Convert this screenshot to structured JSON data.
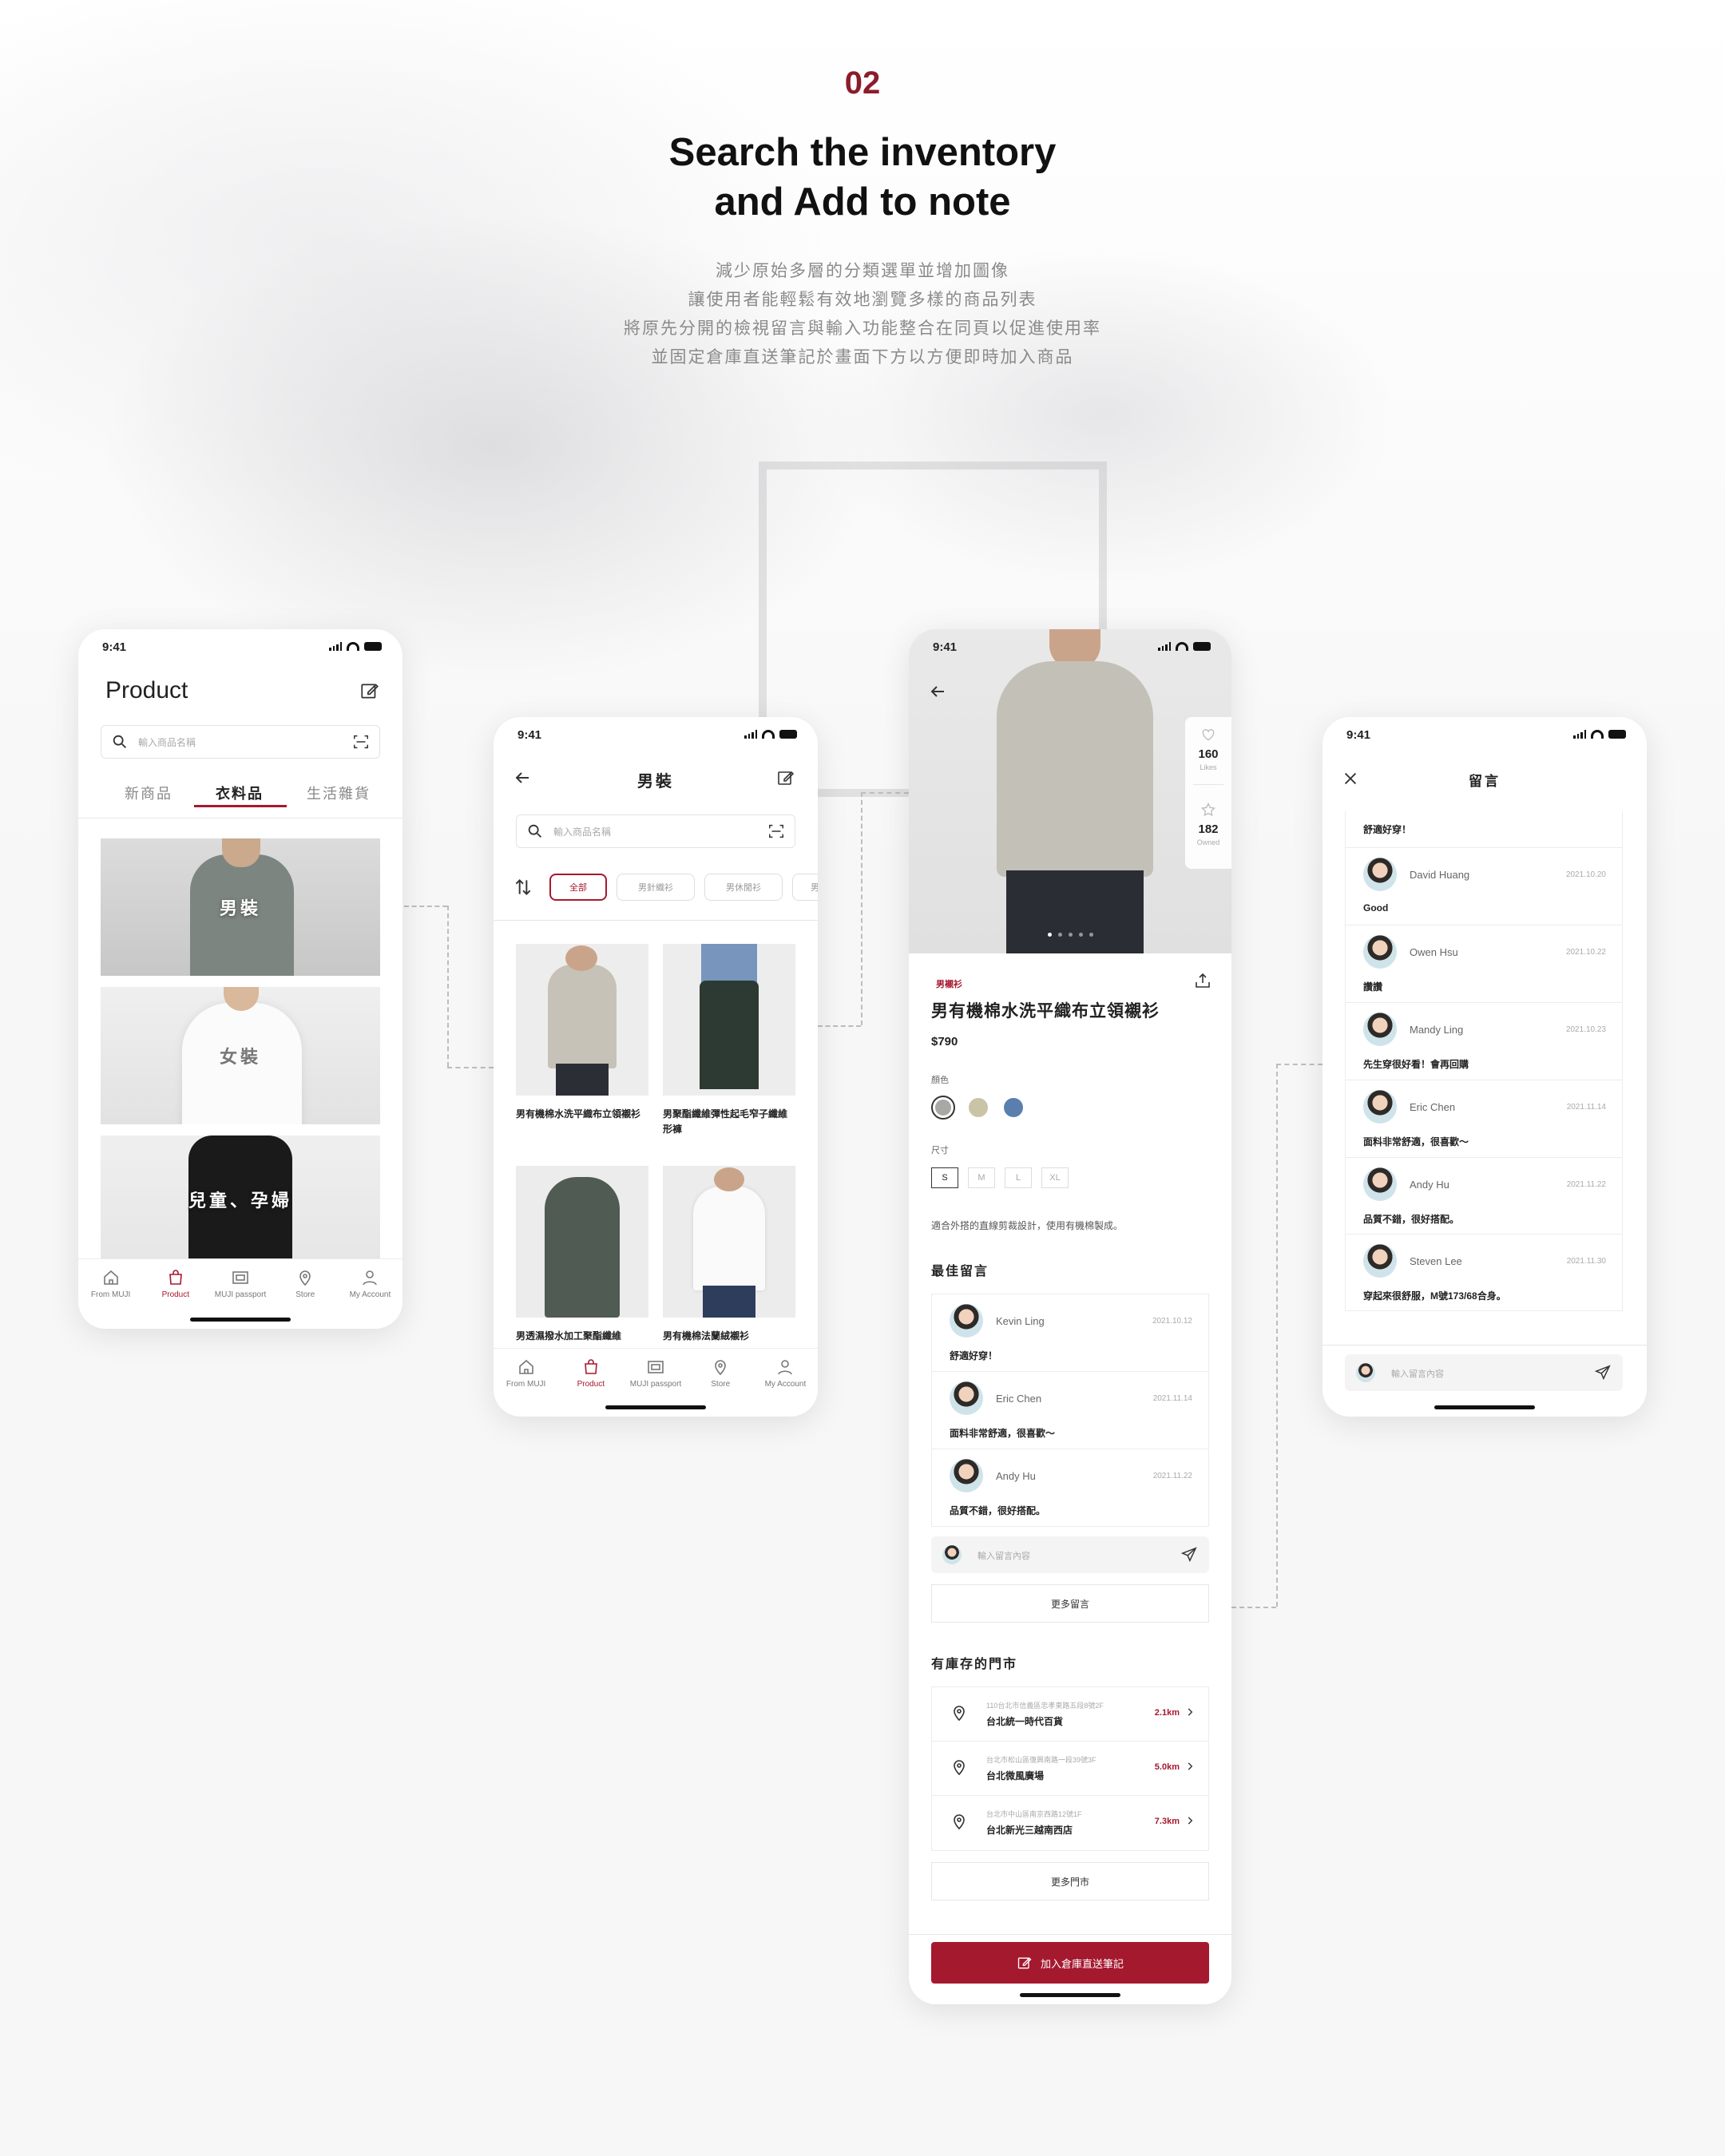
{
  "header": {
    "number": "02",
    "title_line1": "Search the inventory",
    "title_line2": "and Add to note",
    "desc": [
      "減少原始多層的分類選單並增加圖像",
      "讓使用者能輕鬆有效地瀏覽多樣的商品列表",
      "將原先分開的檢視留言與輸入功能整合在同頁以促進使用率",
      "並固定倉庫直送筆記於畫面下方以方便即時加入商品"
    ]
  },
  "status": {
    "time": "9:41"
  },
  "colors": {
    "accent": "#a5192f",
    "number": "#8c1c2b"
  },
  "tabbar": {
    "items": [
      {
        "label": "From MUJI",
        "icon": "home-icon"
      },
      {
        "label": "Product",
        "icon": "shopping-bag-icon"
      },
      {
        "label": "MUJI passport",
        "icon": "passport-icon"
      },
      {
        "label": "Store",
        "icon": "location-pin-icon"
      },
      {
        "label": "My Account",
        "icon": "user-icon"
      }
    ]
  },
  "phone1": {
    "title": "Product",
    "search_placeholder": "輸入商品名稱",
    "tabs": [
      "新商品",
      "衣料品",
      "生活雜貨"
    ],
    "active_tab": 1,
    "categories": [
      "男裝",
      "女裝",
      "兒童、孕婦"
    ]
  },
  "phone2": {
    "title": "男裝",
    "search_placeholder": "輸入商品名稱",
    "chips": [
      "全部",
      "男針織衫",
      "男休閒衫",
      "男"
    ],
    "products": [
      {
        "name": "男有機棉水洗平織布立領襯衫"
      },
      {
        "name": "男聚酯纖維彈性起毛窄子纖維形褲"
      },
      {
        "name": "男透濕撥水加工聚酯纖維"
      },
      {
        "name": "男有機棉法蘭絨襯衫"
      }
    ]
  },
  "phone3": {
    "likes_count": "160",
    "likes_label": "Likes",
    "owned_count": "182",
    "owned_label": "Owned",
    "tag": "男襯衫",
    "product_name": "男有機棉水洗平織布立領襯衫",
    "price": "$790",
    "color_label": "顏色",
    "colors": [
      "#a9a8a4",
      "#c9c4a6",
      "#5a7fae"
    ],
    "size_label": "尺寸",
    "sizes": [
      "S",
      "M",
      "L",
      "XL"
    ],
    "desc": "適合外搭的直線剪裁設計，使用有機棉製成。",
    "best_comments_title": "最佳留言",
    "comments": [
      {
        "name": "Kevin Ling",
        "date": "2021.10.12",
        "text": "舒適好穿！"
      },
      {
        "name": "Eric Chen",
        "date": "2021.11.14",
        "text": "面料非常舒適，很喜歡～"
      },
      {
        "name": "Andy Hu",
        "date": "2021.11.22",
        "text": "品質不錯，很好搭配。"
      }
    ],
    "comment_placeholder": "輸入留言內容",
    "more_comments": "更多留言",
    "stores_title": "有庫存的門市",
    "stores": [
      {
        "addr": "110台北市信義區忠孝東路五段8號2F",
        "name": "台北統一時代百貨",
        "dist": "2.1km"
      },
      {
        "addr": "台北市松山區復興南路一段39號3F",
        "name": "台北微風廣場",
        "dist": "5.0km"
      },
      {
        "addr": "台北市中山區南京西路12號1F",
        "name": "台北新光三越南西店",
        "dist": "7.3km"
      }
    ],
    "more_stores": "更多門市",
    "add_button": "加入倉庫直送筆記"
  },
  "phone4": {
    "title": "留言",
    "top_text": "舒適好穿！",
    "comments": [
      {
        "name": "David Huang",
        "date": "2021.10.20",
        "text": "Good"
      },
      {
        "name": "Owen Hsu",
        "date": "2021.10.22",
        "text": "讚讚"
      },
      {
        "name": "Mandy Ling",
        "date": "2021.10.23",
        "text": "先生穿很好看！會再回購"
      },
      {
        "name": "Eric Chen",
        "date": "2021.11.14",
        "text": "面料非常舒適，很喜歡～"
      },
      {
        "name": "Andy Hu",
        "date": "2021.11.22",
        "text": "品質不錯，很好搭配。"
      },
      {
        "name": "Steven Lee",
        "date": "2021.11.30",
        "text": "穿起來很舒服，M號173/68合身。"
      }
    ],
    "comment_placeholder": "輸入留言內容"
  }
}
